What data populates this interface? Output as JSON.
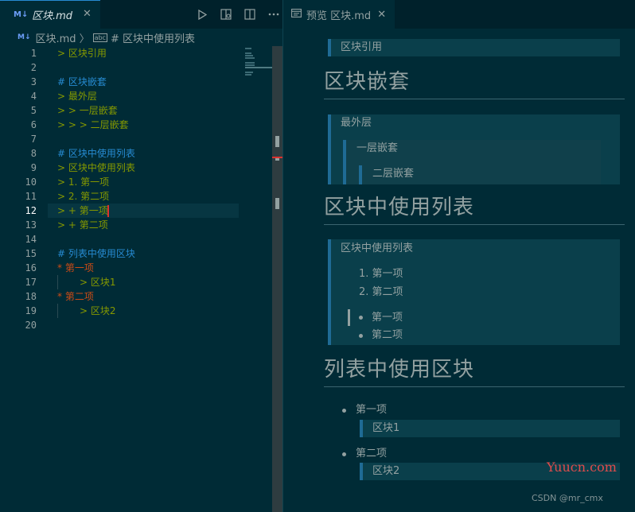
{
  "editor": {
    "tab": {
      "icon": "M↓",
      "title": "区块.md",
      "close": "✕"
    },
    "toolbar": [
      "run-icon",
      "open-preview-icon",
      "split-editor-icon",
      "more-icon"
    ],
    "breadcrumb": {
      "icon": "M↓",
      "file": "区块.md",
      "separator": "〉",
      "symbol_icon": "abc",
      "symbol": "# 区块中使用列表"
    },
    "lines": [
      {
        "n": "1",
        "text": "> 区块引用"
      },
      {
        "n": "2",
        "text": ""
      },
      {
        "n": "3",
        "text": "# 区块嵌套"
      },
      {
        "n": "4",
        "text": "> 最外层"
      },
      {
        "n": "5",
        "text": "> > 一层嵌套"
      },
      {
        "n": "6",
        "text": "> > > 二层嵌套"
      },
      {
        "n": "7",
        "text": ""
      },
      {
        "n": "8",
        "text": "# 区块中使用列表"
      },
      {
        "n": "9",
        "text": "> 区块中使用列表"
      },
      {
        "n": "10",
        "text": "> 1. 第一项"
      },
      {
        "n": "11",
        "text": "> 2. 第二项"
      },
      {
        "n": "12",
        "text": "> + 第一项"
      },
      {
        "n": "13",
        "text": "> + 第二项"
      },
      {
        "n": "14",
        "text": ""
      },
      {
        "n": "15",
        "text": "# 列表中使用区块"
      },
      {
        "n": "16",
        "text": "* 第一项"
      },
      {
        "n": "17",
        "text": "> 区块1"
      },
      {
        "n": "18",
        "text": "* 第二项"
      },
      {
        "n": "19",
        "text": "> 区块2"
      },
      {
        "n": "20",
        "text": ""
      }
    ],
    "active_line": "12",
    "colors": {
      "background": "#002b36",
      "quote": "#859900",
      "heading": "#268bd2",
      "list": "#cb4b16",
      "cursor": "#dc322f"
    }
  },
  "preview": {
    "tab": {
      "icon": "preview-icon",
      "title": "预览 区块.md",
      "close": "✕"
    },
    "quote1": "区块引用",
    "h_nesting": "区块嵌套",
    "outer": "最外层",
    "level1": "一层嵌套",
    "level2": "二层嵌套",
    "h_list_in_quote": "区块中使用列表",
    "quote_list_title": "区块中使用列表",
    "ol": [
      "1. 第一项",
      "2. 第二项"
    ],
    "ul": [
      "第一项",
      "第二项"
    ],
    "h_quote_in_list": "列表中使用区块",
    "list_items": [
      {
        "label": "第一项",
        "quote": "区块1"
      },
      {
        "label": "第二项",
        "quote": "区块2"
      }
    ]
  },
  "watermark": "Yuucn.com",
  "credit": "CSDN @mr_cmx"
}
